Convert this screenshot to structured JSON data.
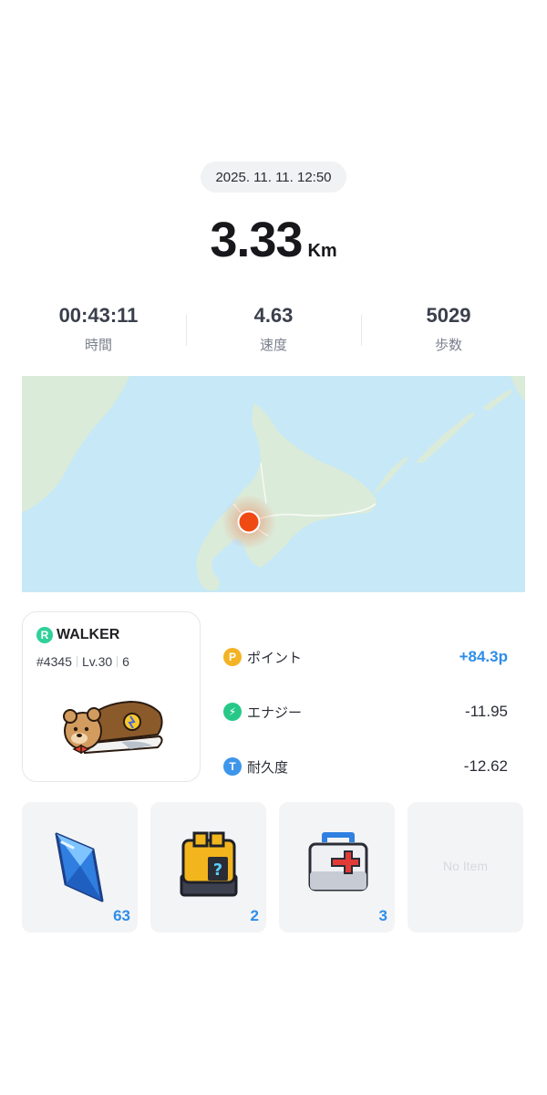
{
  "session": {
    "datetime": "2025. 11. 11. 12:50",
    "distance": "3.33",
    "distance_unit": "Km"
  },
  "stats": [
    {
      "value": "00:43:11",
      "label": "時間"
    },
    {
      "value": "4.63",
      "label": "速度"
    },
    {
      "value": "5029",
      "label": "歩数"
    }
  ],
  "map": {
    "sea_color": "#c7e8f6",
    "land_color": "#dbebd9",
    "marker_color": "#f04a14"
  },
  "walker": {
    "badge": "R",
    "name": "WALKER",
    "id": "#4345",
    "level": "Lv.30",
    "extra_icon": "6"
  },
  "rewards": [
    {
      "icon": "P",
      "icon_color": "#f3b324",
      "label": "ポイント",
      "value": "+84.3p"
    },
    {
      "icon": "⚡",
      "icon_color": "#27c887",
      "label": "エナジー",
      "value": "-11.95"
    },
    {
      "icon": "T",
      "icon_color": "#3d96ea",
      "label": "耐久度",
      "value": "-12.62"
    }
  ],
  "items": [
    {
      "icon": "gem-icon",
      "count": "63"
    },
    {
      "icon": "mystery-box-icon",
      "count": "2"
    },
    {
      "icon": "repair-kit-icon",
      "count": "3"
    },
    {
      "icon": "",
      "count": "",
      "empty_label": "No Item"
    }
  ]
}
